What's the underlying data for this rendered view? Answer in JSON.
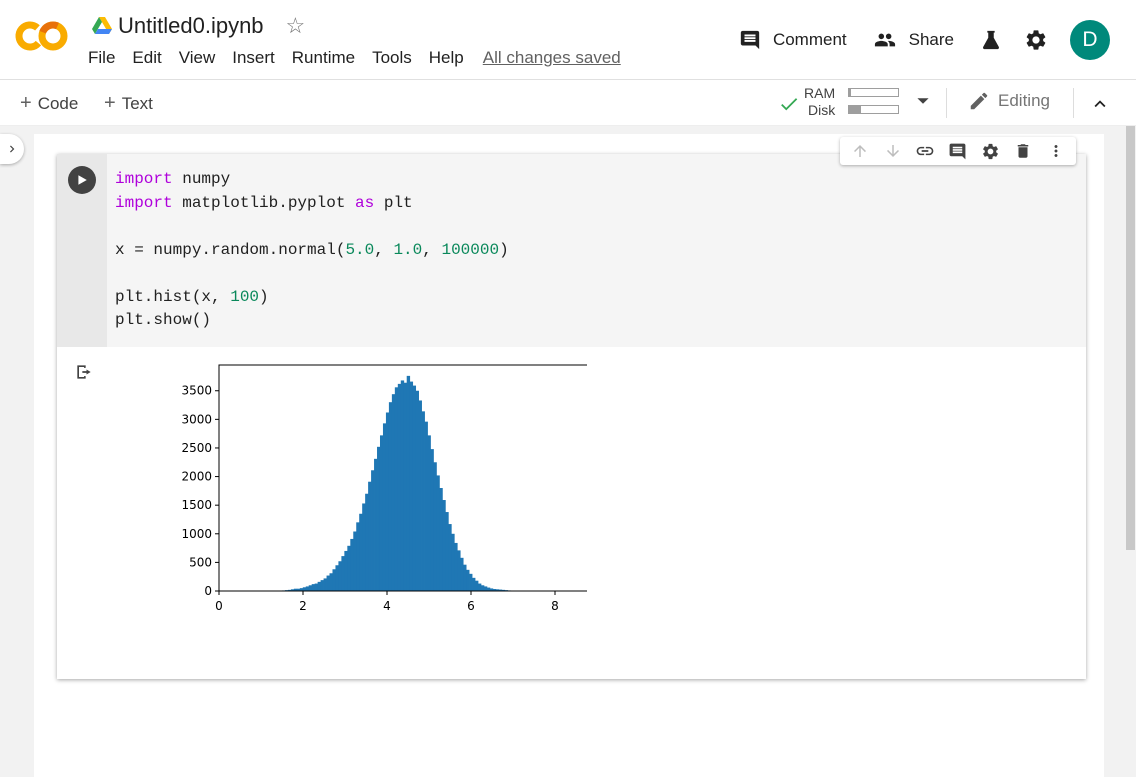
{
  "app": {
    "notebook_title": "Untitled0.ipynb",
    "menu": [
      "File",
      "Edit",
      "View",
      "Insert",
      "Runtime",
      "Tools",
      "Help"
    ],
    "save_status": "All changes saved",
    "comment_label": "Comment",
    "share_label": "Share",
    "avatar_letter": "D",
    "avatar_color": "#00897b"
  },
  "toolbar": {
    "add_code": "Code",
    "add_text": "Text",
    "ram_label": "RAM",
    "disk_label": "Disk",
    "ram_usage": 0.05,
    "disk_usage": 0.25,
    "editing_label": "Editing"
  },
  "cell": {
    "code": [
      [
        {
          "t": "import",
          "c": "kw"
        },
        {
          "t": " numpy",
          "c": ""
        }
      ],
      [
        {
          "t": "import",
          "c": "kw"
        },
        {
          "t": " matplotlib.pyplot ",
          "c": ""
        },
        {
          "t": "as",
          "c": "kw"
        },
        {
          "t": " plt",
          "c": ""
        }
      ],
      [],
      [
        {
          "t": "x = numpy.random.normal(",
          "c": ""
        },
        {
          "t": "5.0",
          "c": "num"
        },
        {
          "t": ", ",
          "c": ""
        },
        {
          "t": "1.0",
          "c": "num"
        },
        {
          "t": ", ",
          "c": ""
        },
        {
          "t": "100000",
          "c": "num"
        },
        {
          "t": ")",
          "c": ""
        }
      ],
      [],
      [
        {
          "t": "plt.hist(x, ",
          "c": ""
        },
        {
          "t": "100",
          "c": "num"
        },
        {
          "t": ")",
          "c": ""
        }
      ],
      [
        {
          "t": "plt.show()",
          "c": ""
        }
      ]
    ],
    "toolbar_icons": [
      "arrow-up-icon",
      "arrow-down-icon",
      "link-icon",
      "comment-icon",
      "gear-icon",
      "trash-icon",
      "more-vert-icon"
    ]
  },
  "chart_data": {
    "type": "bar",
    "title": "",
    "xlabel": "",
    "ylabel": "",
    "xlim": [
      0,
      10
    ],
    "ylim": [
      0,
      3950
    ],
    "xticks": [
      0,
      2,
      4,
      6,
      8
    ],
    "yticks": [
      0,
      500,
      1000,
      1500,
      2000,
      2500,
      3000,
      3500
    ],
    "color": "#1f77b4",
    "bin_start": 1.5,
    "bin_width": 0.0707,
    "values": [
      10,
      15,
      20,
      30,
      40,
      40,
      50,
      65,
      80,
      100,
      120,
      130,
      160,
      190,
      220,
      270,
      310,
      380,
      450,
      520,
      610,
      700,
      790,
      910,
      1040,
      1200,
      1350,
      1530,
      1700,
      1910,
      2110,
      2310,
      2520,
      2720,
      2930,
      3120,
      3300,
      3440,
      3560,
      3620,
      3680,
      3640,
      3760,
      3660,
      3590,
      3500,
      3330,
      3140,
      2960,
      2720,
      2480,
      2250,
      2020,
      1800,
      1590,
      1380,
      1170,
      1000,
      840,
      710,
      580,
      460,
      370,
      300,
      230,
      180,
      130,
      100,
      80,
      60,
      45,
      35,
      30,
      25,
      20,
      15,
      10
    ]
  }
}
